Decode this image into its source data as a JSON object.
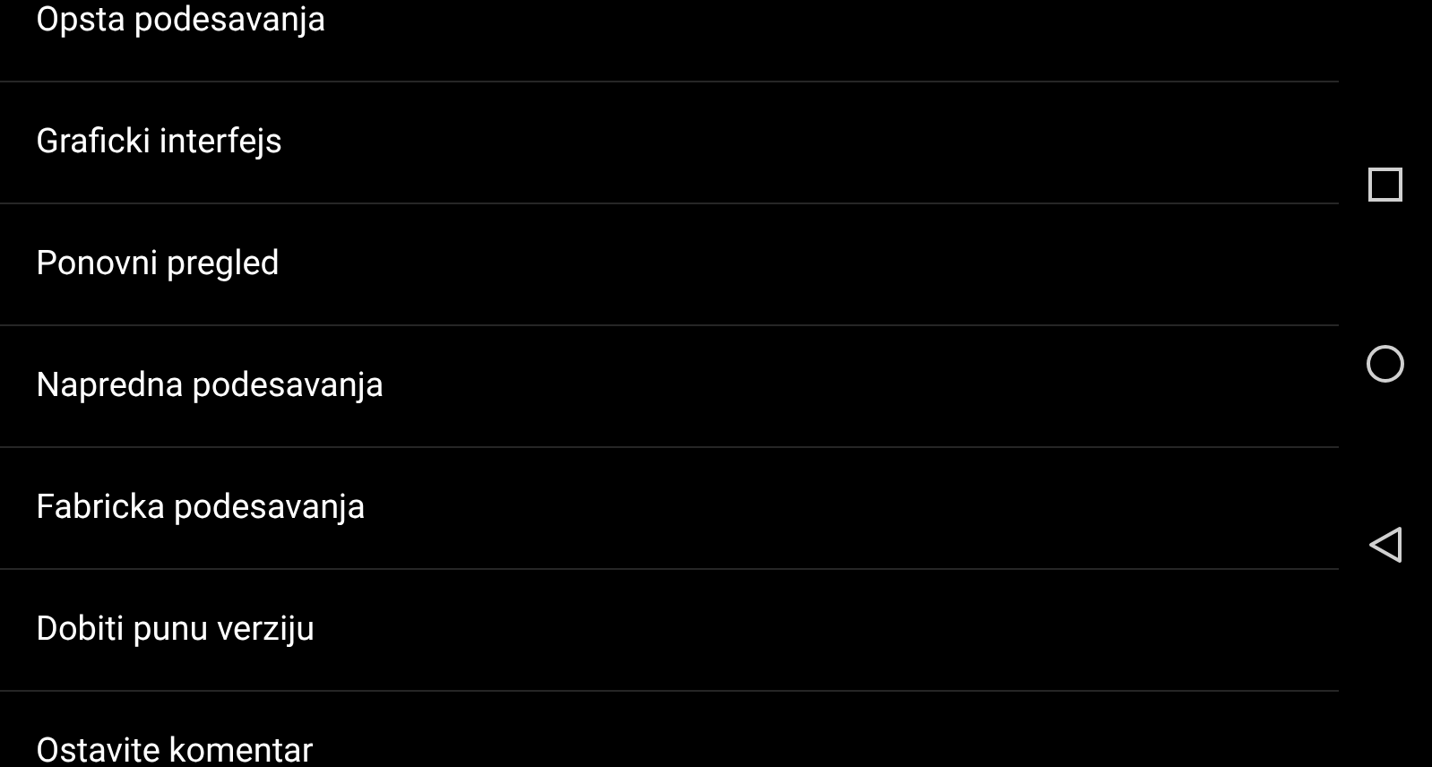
{
  "menu": {
    "items": [
      {
        "label": "Opsta podesavanja"
      },
      {
        "label": "Graficki interfejs"
      },
      {
        "label": "Ponovni pregled"
      },
      {
        "label": "Napredna podesavanja"
      },
      {
        "label": "Fabricka podesavanja"
      },
      {
        "label": "Dobiti punu verziju"
      },
      {
        "label": "Ostavite komentar"
      }
    ]
  }
}
